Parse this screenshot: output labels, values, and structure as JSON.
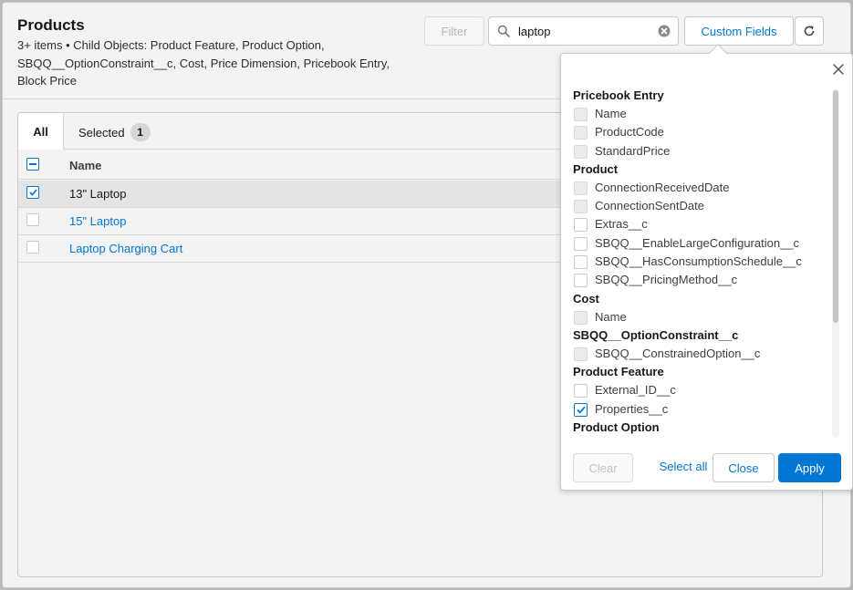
{
  "header": {
    "title": "Products",
    "subtitle": "3+ items • Child Objects: Product Feature, Product Option, SBQQ__OptionConstraint__c, Cost, Price Dimension, Pricebook Entry, Block Price"
  },
  "toolbar": {
    "filter_label": "Filter",
    "search_value": "laptop",
    "custom_fields_label": "Custom Fields"
  },
  "tabs": {
    "all_label": "All",
    "selected_label": "Selected",
    "selected_count": "1"
  },
  "table": {
    "column_name": "Name",
    "rows": [
      {
        "name": "13\" Laptop",
        "selected": true
      },
      {
        "name": "15\" Laptop",
        "selected": false
      },
      {
        "name": "Laptop Charging Cart",
        "selected": false
      }
    ]
  },
  "popover": {
    "groups": [
      {
        "title": "Pricebook Entry",
        "fields": [
          {
            "label": "Name",
            "state": "disabled"
          },
          {
            "label": "ProductCode",
            "state": "disabled"
          },
          {
            "label": "StandardPrice",
            "state": "disabled"
          }
        ]
      },
      {
        "title": "Product",
        "fields": [
          {
            "label": "ConnectionReceivedDate",
            "state": "disabled"
          },
          {
            "label": "ConnectionSentDate",
            "state": "disabled"
          },
          {
            "label": "Extras__c",
            "state": "unchecked"
          },
          {
            "label": "SBQQ__EnableLargeConfiguration__c",
            "state": "unchecked"
          },
          {
            "label": "SBQQ__HasConsumptionSchedule__c",
            "state": "unchecked"
          },
          {
            "label": "SBQQ__PricingMethod__c",
            "state": "unchecked"
          }
        ]
      },
      {
        "title": "Cost",
        "fields": [
          {
            "label": "Name",
            "state": "disabled"
          }
        ]
      },
      {
        "title": "SBQQ__OptionConstraint__c",
        "fields": [
          {
            "label": "SBQQ__ConstrainedOption__c",
            "state": "disabled"
          }
        ]
      },
      {
        "title": "Product Feature",
        "fields": [
          {
            "label": "External_ID__c",
            "state": "unchecked"
          },
          {
            "label": "Properties__c",
            "state": "checked"
          }
        ]
      },
      {
        "title": "Product Option",
        "fields": []
      }
    ],
    "clear_label": "Clear",
    "select_all_label": "Select all",
    "close_label": "Close",
    "apply_label": "Apply"
  },
  "colors": {
    "accent": "#0176d3"
  }
}
